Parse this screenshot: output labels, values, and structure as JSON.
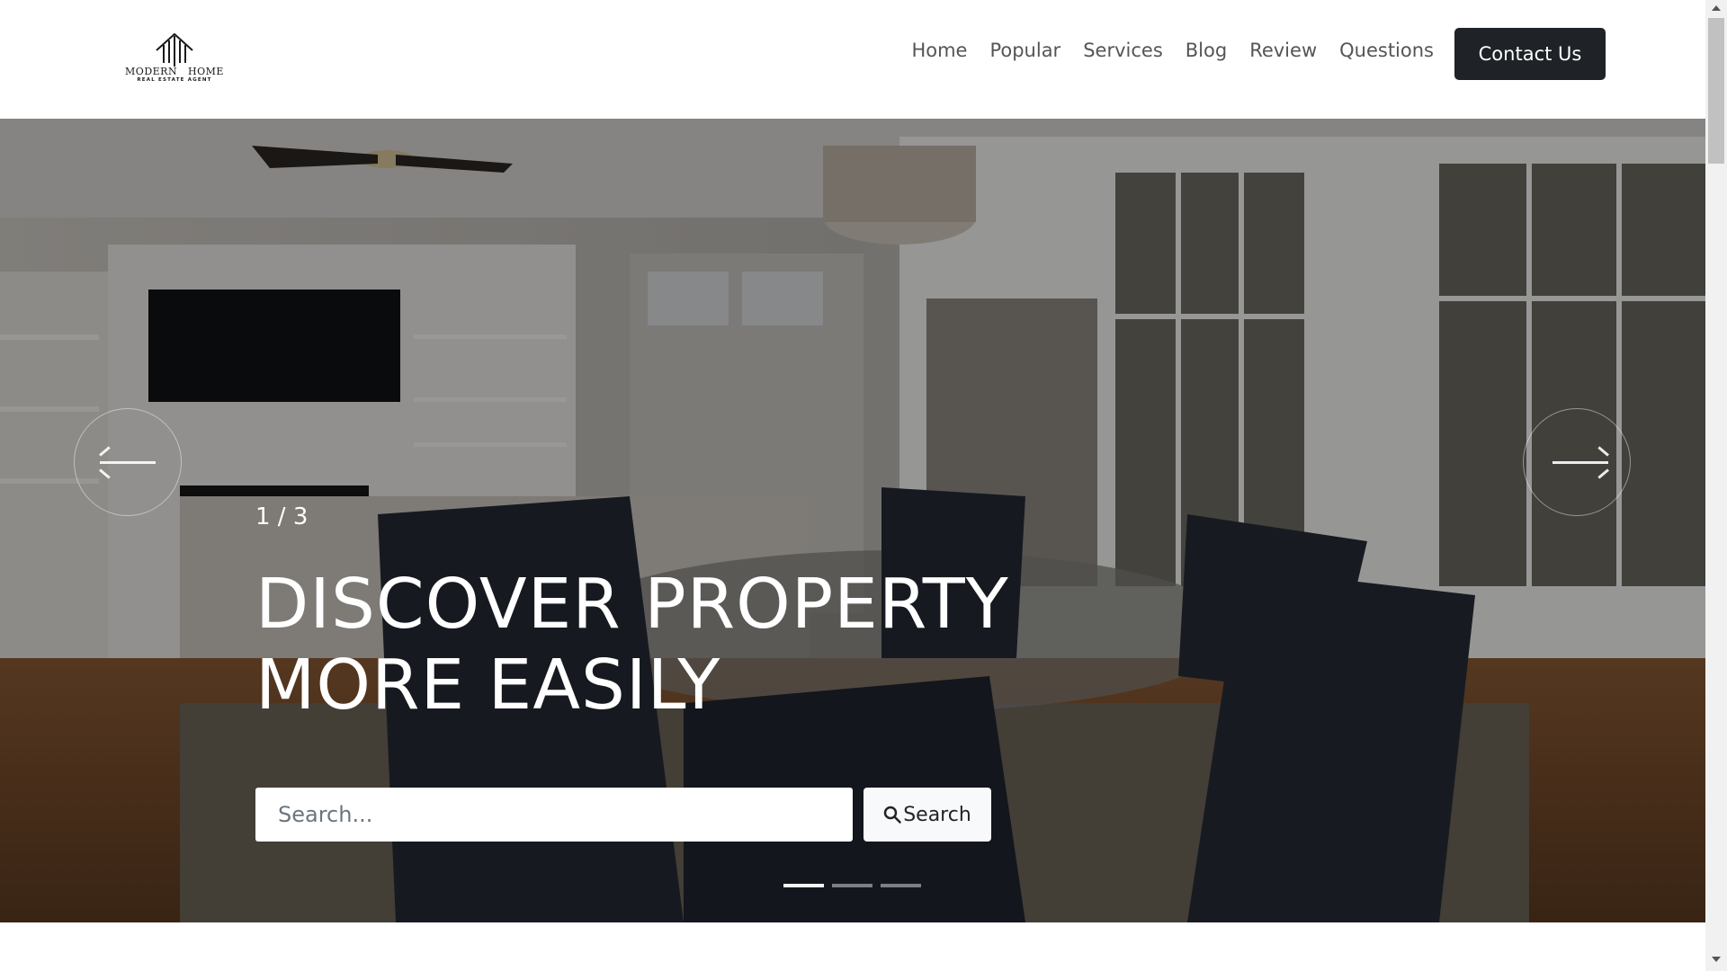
{
  "logo": {
    "primary": "MODERN   HOME",
    "secondary": "REAL ESTATE AGENT"
  },
  "nav": {
    "items": [
      "Home",
      "Popular",
      "Services",
      "Blog",
      "Review",
      "Questions"
    ],
    "contact_label": "Contact Us"
  },
  "hero": {
    "counter": "1 / 3",
    "title_line1": "DISCOVER PROPERTY",
    "title_line2": "MORE EASILY",
    "search_placeholder": "Search...",
    "search_button": "Search",
    "active_slide": 1,
    "slide_count": 3
  },
  "colors": {
    "contact_button": "#1f2327",
    "overlay": "rgba(0,0,0,0.38)"
  },
  "icons": {
    "prev": "arrow-left-icon",
    "next": "arrow-right-icon",
    "search": "search-icon"
  }
}
